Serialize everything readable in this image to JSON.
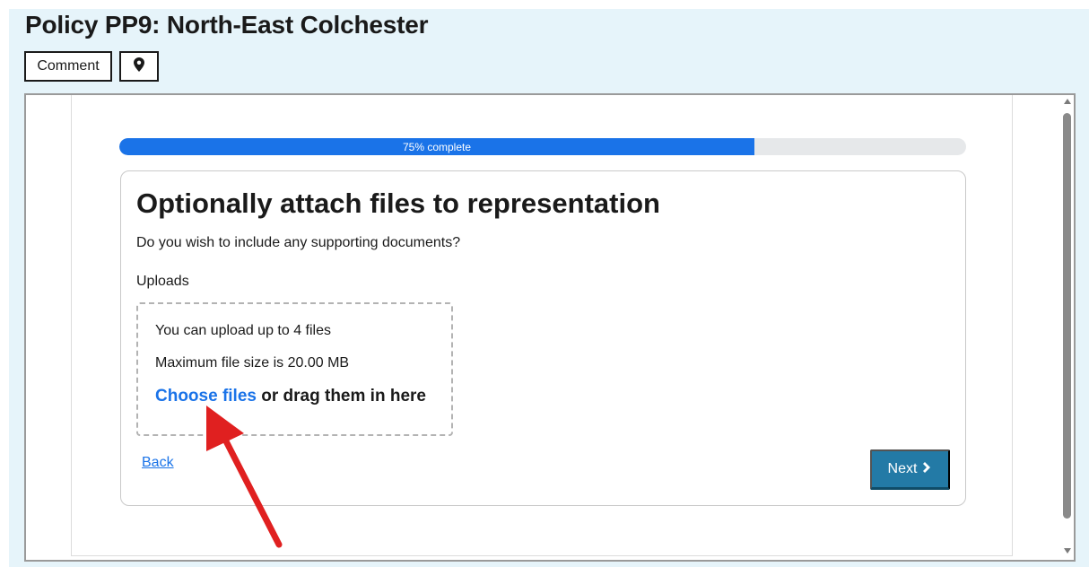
{
  "page": {
    "title": "Policy PP9: North-East Colchester"
  },
  "toolbar": {
    "comment_label": "Comment",
    "location_icon": "map-pin-icon"
  },
  "progress": {
    "label": "75% complete",
    "value": 0.75
  },
  "form": {
    "heading": "Optionally attach files to representation",
    "question": "Do you wish to include any supporting documents?",
    "uploads_label": "Uploads",
    "upload_limit_text": "You can upload up to 4 files",
    "max_size_text": "Maximum file size is 20.00 MB",
    "choose_files_link": "Choose files",
    "drag_text": "or drag them in here",
    "back_label": "Back",
    "next_label": "Next",
    "next_icon": "chevron-right-icon"
  },
  "colors": {
    "page_background": "#e6f4fa",
    "progress_fill": "#1a73e8",
    "link": "#1a73e8",
    "next_button": "#237aa6",
    "annotation_arrow": "#e02020"
  }
}
